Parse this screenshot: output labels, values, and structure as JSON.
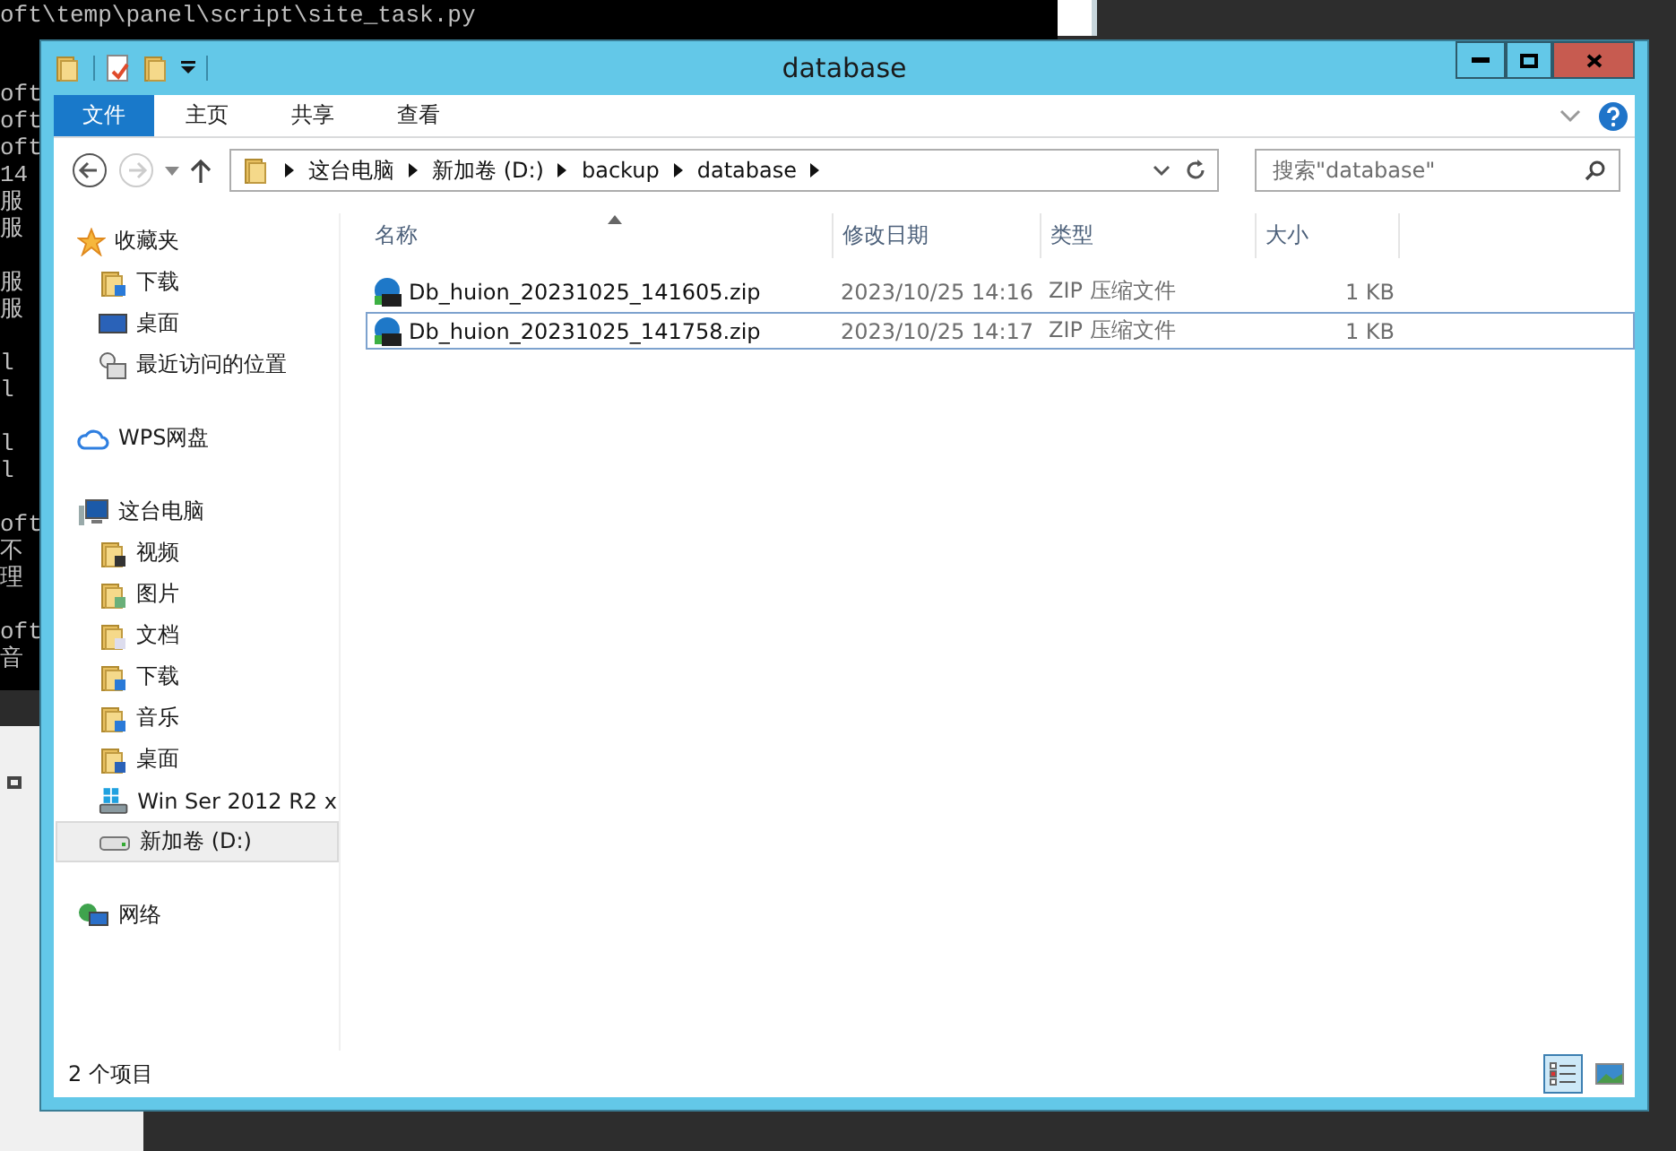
{
  "console": {
    "top_lines": [
      "oft\\temp\\panel\\script\\site_task.py"
    ],
    "side_blocks": [
      [
        "oft",
        "oft",
        "oft",
        "14",
        "服",
        "服"
      ],
      [
        "服",
        "服"
      ],
      [
        "l",
        "l"
      ],
      [
        "l",
        "l"
      ],
      [
        "oft",
        "不",
        "理"
      ],
      [
        "oft",
        "音"
      ]
    ]
  },
  "window": {
    "title": "database"
  },
  "ribbon_tabs": [
    {
      "label": "文件",
      "selected": true
    },
    {
      "label": "主页",
      "selected": false
    },
    {
      "label": "共享",
      "selected": false
    },
    {
      "label": "查看",
      "selected": false
    }
  ],
  "address": {
    "crumbs": [
      "这台电脑",
      "新加卷 (D:)",
      "backup",
      "database"
    ]
  },
  "search": {
    "placeholder": "搜索\"database\""
  },
  "sidebar": {
    "groups": [
      {
        "label": "收藏夹",
        "children": [
          {
            "label": "下载",
            "selected": false
          },
          {
            "label": "桌面",
            "selected": false
          },
          {
            "label": "最近访问的位置",
            "selected": false
          }
        ]
      },
      {
        "label": "WPS网盘"
      },
      {
        "label": "这台电脑",
        "children": [
          {
            "label": "视频",
            "selected": false
          },
          {
            "label": "图片",
            "selected": false
          },
          {
            "label": "文档",
            "selected": false
          },
          {
            "label": "下载",
            "selected": false
          },
          {
            "label": "音乐",
            "selected": false
          },
          {
            "label": "桌面",
            "selected": false
          },
          {
            "label": "Win Ser 2012 R2 x",
            "selected": false
          },
          {
            "label": "新加卷 (D:)",
            "selected": true
          }
        ]
      },
      {
        "label": "网络"
      }
    ]
  },
  "table": {
    "columns": [
      "名称",
      "修改日期",
      "类型",
      "大小"
    ],
    "rows": [
      {
        "name": "Db_huion_20231025_141605.zip",
        "date": "2023/10/25 14:16",
        "type": "ZIP 压缩文件",
        "size": "1 KB",
        "selected": false
      },
      {
        "name": "Db_huion_20231025_141758.zip",
        "date": "2023/10/25 14:17",
        "type": "ZIP 压缩文件",
        "size": "1 KB",
        "selected": true
      }
    ]
  },
  "status_bar": {
    "count": "2 个项目",
    "views": [
      {
        "kind": "details",
        "selected": true
      },
      {
        "kind": "large",
        "selected": false
      }
    ]
  }
}
